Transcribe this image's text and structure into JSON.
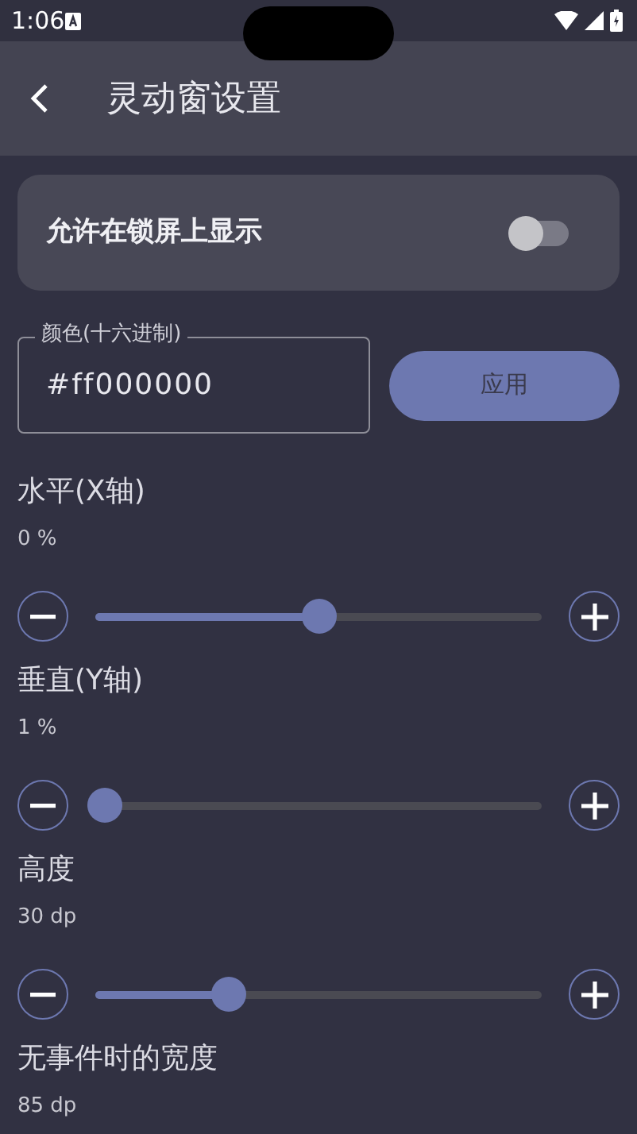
{
  "status_bar": {
    "time": "1:06"
  },
  "app_bar": {
    "title": "灵动窗设置"
  },
  "lock_screen": {
    "label": "允许在锁屏上显示",
    "on": false
  },
  "color_field": {
    "label": "颜色(十六进制)",
    "value": "#ff000000"
  },
  "apply_button": {
    "label": "应用"
  },
  "sliders": [
    {
      "title": "水平(X轴)",
      "reading": "0 %",
      "level": 0.5
    },
    {
      "title": "垂直(Y轴)",
      "reading": "1 %",
      "level": 0.02
    },
    {
      "title": "高度",
      "reading": "30 dp",
      "level": 0.3
    },
    {
      "title": "无事件时的宽度",
      "reading": "85 dp"
    }
  ]
}
